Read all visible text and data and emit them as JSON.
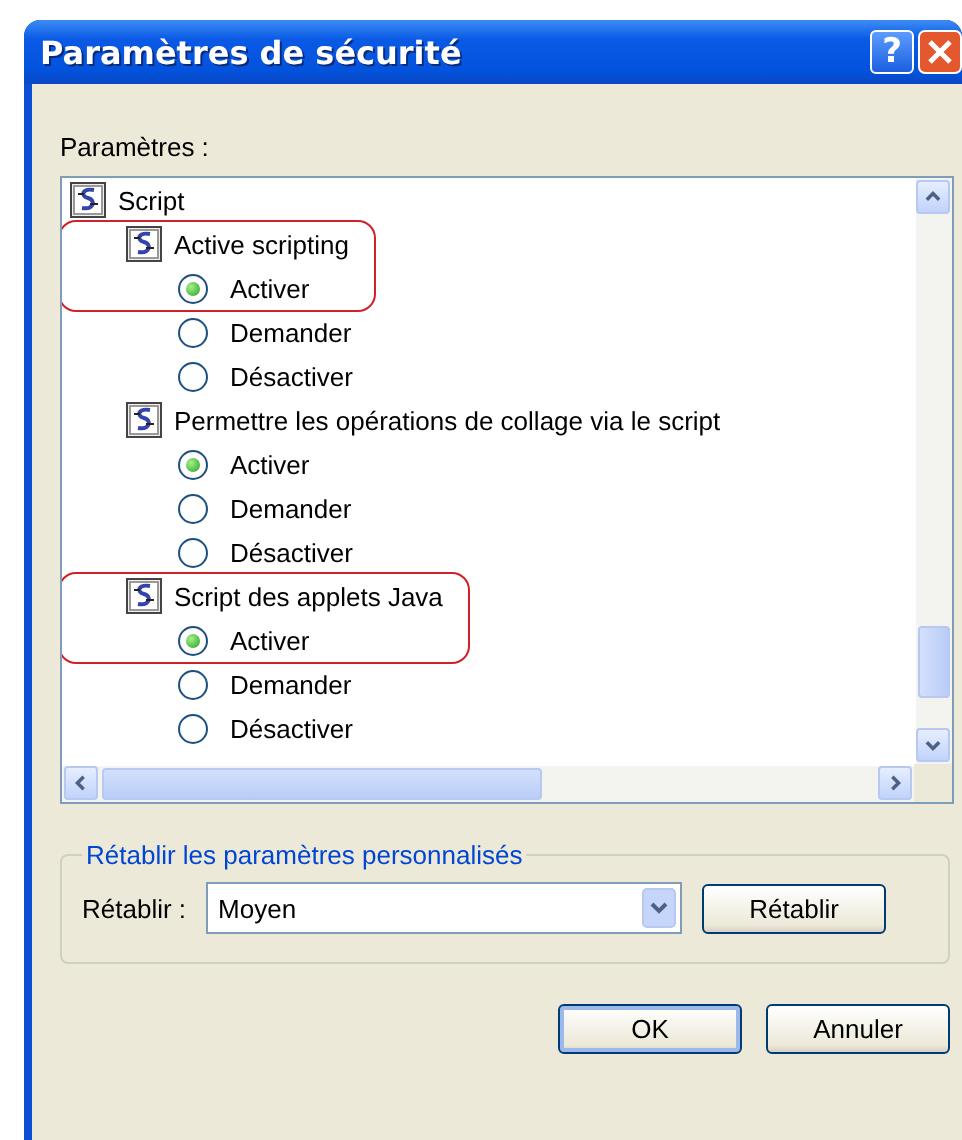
{
  "window": {
    "title": "Paramètres de sécurité",
    "help_button": "?"
  },
  "settings": {
    "label": "Paramètres :",
    "tree": {
      "label": "Script",
      "children": [
        {
          "label": "Active scripting",
          "highlighted": true,
          "options": [
            {
              "label": "Activer",
              "selected": true
            },
            {
              "label": "Demander",
              "selected": false
            },
            {
              "label": "Désactiver",
              "selected": false
            }
          ]
        },
        {
          "label": "Permettre les opérations de collage via le script",
          "highlighted": false,
          "options": [
            {
              "label": "Activer",
              "selected": true
            },
            {
              "label": "Demander",
              "selected": false
            },
            {
              "label": "Désactiver",
              "selected": false
            }
          ]
        },
        {
          "label": "Script des applets Java",
          "highlighted": true,
          "options": [
            {
              "label": "Activer",
              "selected": true
            },
            {
              "label": "Demander",
              "selected": false
            },
            {
              "label": "Désactiver",
              "selected": false
            }
          ]
        }
      ]
    }
  },
  "reset": {
    "legend": "Rétablir les paramètres personnalisés",
    "label": "Rétablir :",
    "value": "Moyen",
    "button": "Rétablir"
  },
  "buttons": [
    {
      "label": "OK",
      "default": true
    },
    {
      "label": "Annuler",
      "default": false
    }
  ]
}
